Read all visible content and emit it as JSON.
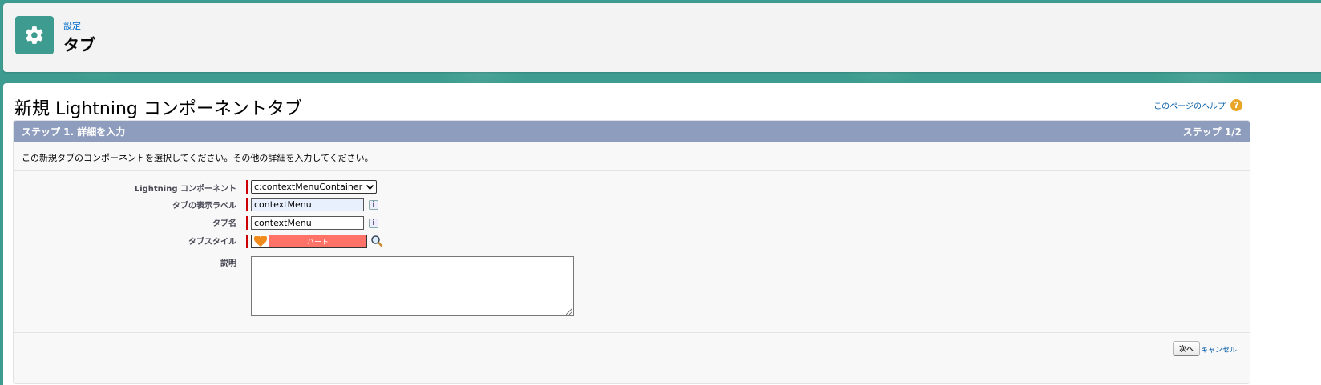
{
  "header": {
    "breadcrumb": "設定",
    "title": "タブ",
    "icon": "gear-icon"
  },
  "form": {
    "title": "新規 Lightning コンポーネントタブ",
    "help_link": "このページのヘルプ",
    "step_label": "ステップ 1. 詳細を入力",
    "step_counter": "ステップ 1/2",
    "description": "この新規タブのコンポーネントを選択してください。その他の詳細を入力してください。",
    "fields": {
      "component_label": "Lightning コンポーネント",
      "component_value": "c:contextMenuContainer",
      "display_label_label": "タブの表示ラベル",
      "display_label_value": "contextMenu",
      "tab_name_label": "タブ名",
      "tab_name_value": "contextMenu",
      "tab_style_label": "タブスタイル",
      "tab_style_value": "ハート",
      "description_label": "説明",
      "description_value": ""
    },
    "buttons": {
      "next": "次へ",
      "cancel": "キャンセル"
    }
  },
  "colors": {
    "brand_teal": "#3d9c8f",
    "step_bar": "#8e9dbe",
    "tab_style": "#fe7268",
    "required": "#cc0000",
    "link": "#015ba7"
  }
}
